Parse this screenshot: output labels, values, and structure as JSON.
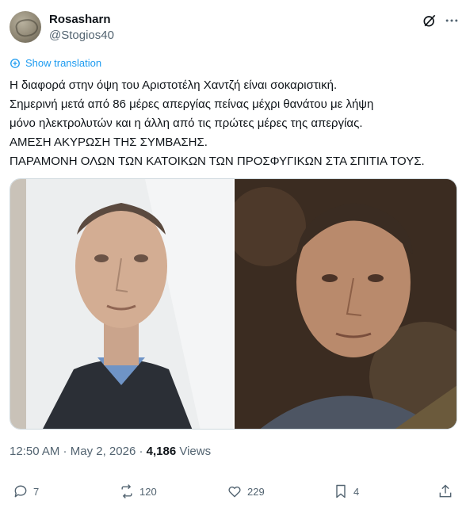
{
  "author": {
    "name": "Rosasharn",
    "handle": "@Stogios40"
  },
  "header_icons": [
    "grok-icon",
    "more-icon"
  ],
  "translate_label": "Show translation",
  "text_lines": [
    "Η διαφορά στην όψη του Αριστοτέλη Χαντζή είναι σοκαριστική.",
    "Σημερινή μετά από  86 μέρες απεργίας πείνας μέχρι θανάτου με λήψη",
    "μόνο ηλεκτρολυτών και η άλλη από τις πρώτες μέρες της απεργίας.",
    "ΑΜΕΣΗ ΑΚΥΡΩΣΗ ΤΗΣ ΣΥΜΒΑΣΗΣ.",
    "ΠΑΡΑΜΟΝΗ ΟΛΩΝ ΤΩΝ ΚΑΤΟΙΚΩΝ ΤΩΝ ΠΡΟΣΦΥΓΙΚΩΝ ΣΤΑ ΣΠΙΤΙΑ ΤΟΥΣ."
  ],
  "meta": {
    "time": "12:50 AM",
    "sep1": " · ",
    "date": "May 2, 2026",
    "sep2": " · ",
    "views_count": "4,186",
    "views_label": " Views"
  },
  "actions": {
    "replies": "7",
    "reposts": "120",
    "likes": "229",
    "bookmarks": "4"
  },
  "colors": {
    "accent": "#1d9bf0",
    "muted": "#536471",
    "text": "#0f1419"
  }
}
